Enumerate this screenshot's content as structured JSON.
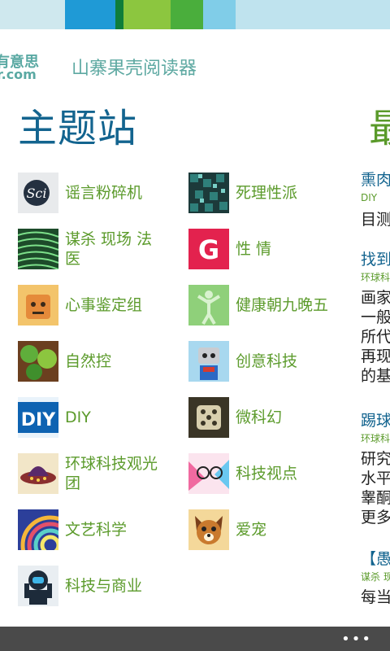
{
  "header": {
    "logo_line1": "有意思",
    "logo_line2": "r.com",
    "app_title": "山寨果壳阅读器"
  },
  "section": {
    "title": "主题站",
    "next_title_peek": "最"
  },
  "topics": [
    {
      "label": "谣言粉碎机",
      "icon": "sci-icon"
    },
    {
      "label": "死理性派",
      "icon": "cubes-icon"
    },
    {
      "label": "谋杀 现场 法医",
      "icon": "fingerprint-icon"
    },
    {
      "label": "性 情",
      "icon": "g-icon"
    },
    {
      "label": "心事鉴定组",
      "icon": "face-icon"
    },
    {
      "label": "健康朝九晚五",
      "icon": "figure-icon"
    },
    {
      "label": "自然控",
      "icon": "trees-icon"
    },
    {
      "label": "创意科技",
      "icon": "robot-icon"
    },
    {
      "label": "DIY",
      "icon": "diy-icon"
    },
    {
      "label": "微科幻",
      "icon": "dice-icon"
    },
    {
      "label": "环球科技观光团",
      "icon": "ufo-icon"
    },
    {
      "label": "科技视点",
      "icon": "glasses-icon"
    },
    {
      "label": "文艺科学",
      "icon": "swirl-icon"
    },
    {
      "label": "爱宠",
      "icon": "dog-icon"
    },
    {
      "label": "科技与商业",
      "icon": "astronaut-icon"
    }
  ],
  "peek": {
    "a_title": "熏肉",
    "a_cat": "DIY",
    "a_body": "目测",
    "b_title": "找到",
    "b_cat": "环球科",
    "b_body1": "画家",
    "b_body2": "一般",
    "b_body3": "所代",
    "b_body4": "再现",
    "b_body5": "的基",
    "c_title": "踢球",
    "c_cat": "环球科",
    "c_body1": "研究",
    "c_body2": "水平",
    "c_body3": "睾酮",
    "c_body4": "更多",
    "d_title": "【愚",
    "d_cat": "谋杀 现",
    "d_body": "每当"
  },
  "appbar": {
    "more_label": "•••"
  }
}
